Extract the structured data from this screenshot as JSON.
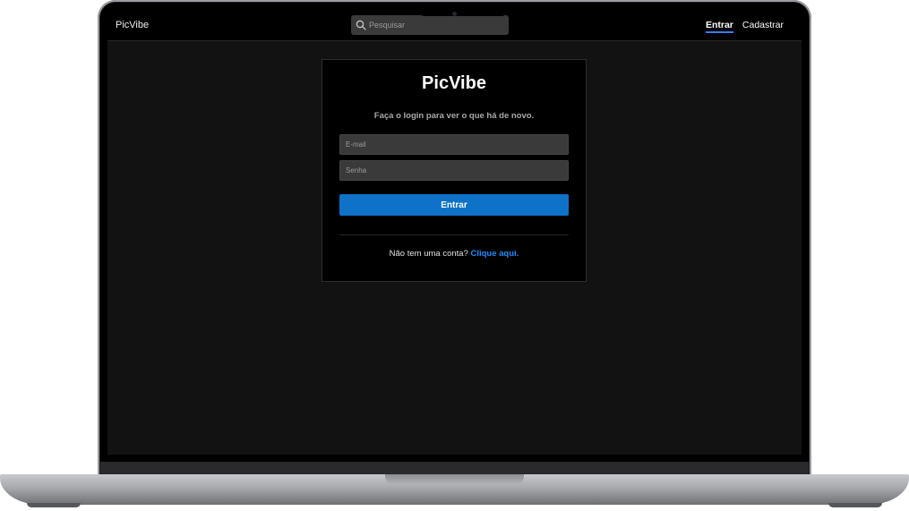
{
  "app": {
    "brand": "PicVibe"
  },
  "nav": {
    "search_placeholder": "Pesquisar",
    "login_label": "Entrar",
    "register_label": "Cadastrar"
  },
  "login": {
    "title": "PicVibe",
    "subtitle": "Faça o login para ver o que há de novo.",
    "email_placeholder": "E-mail",
    "password_placeholder": "Senha",
    "submit_label": "Entrar",
    "signup_prompt": "Não tem uma conta? ",
    "signup_link": "Clique aqui."
  },
  "colors": {
    "accent": "#0f72c9",
    "link": "#1e8cff",
    "background": "#121212"
  }
}
